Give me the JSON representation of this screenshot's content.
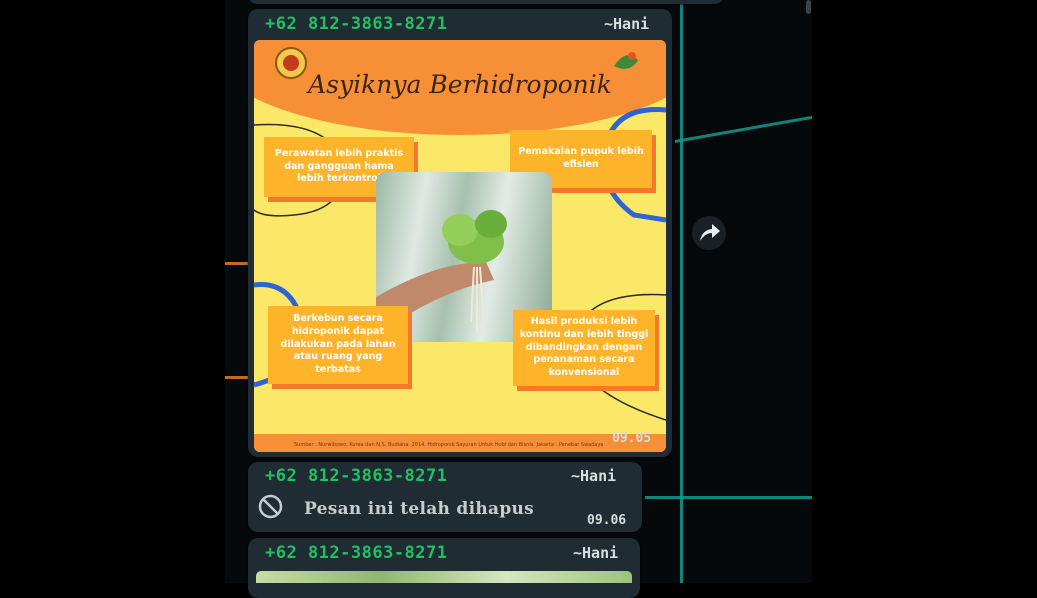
{
  "messages": [
    {
      "sender": "+62 812-3863-8271",
      "author": "~Hani",
      "time": "09.05",
      "poster": {
        "title": "Asyiknya Berhidroponik",
        "cards": [
          "Perawatan lebih praktis dan gangguan hama lebih terkontrol",
          "Pemakaian pupuk lebih efisien",
          "Berkebun secara hidroponik dapat dilakukan pada lahan atau ruang yang terbatas",
          "Hasil produksi lebih kontinu dan lebih tinggi dibandingkan dengan penanaman secara konvensional"
        ],
        "source": "Sumber : Nurwibowo, Kurea dan N.S. Budiana. 2014. Hidroponik Sayuran Untuk Hobi dan Bisnis. Jakarta : Penebar Swadaya"
      }
    },
    {
      "sender": "+62 812-3863-8271",
      "author": "~Hani",
      "time": "09.06",
      "deleted_text": "Pesan ini telah dihapus"
    },
    {
      "sender": "+62 812-3863-8271",
      "author": "~Hani"
    }
  ],
  "icons": {
    "forward": "forward-icon",
    "deleted": "blocked-icon"
  },
  "colors": {
    "sender": "#21c063",
    "bubble": "#1f2c33",
    "poster_bg": "#fbe869",
    "poster_accent": "#f78f36",
    "card": "#fdb42b"
  }
}
